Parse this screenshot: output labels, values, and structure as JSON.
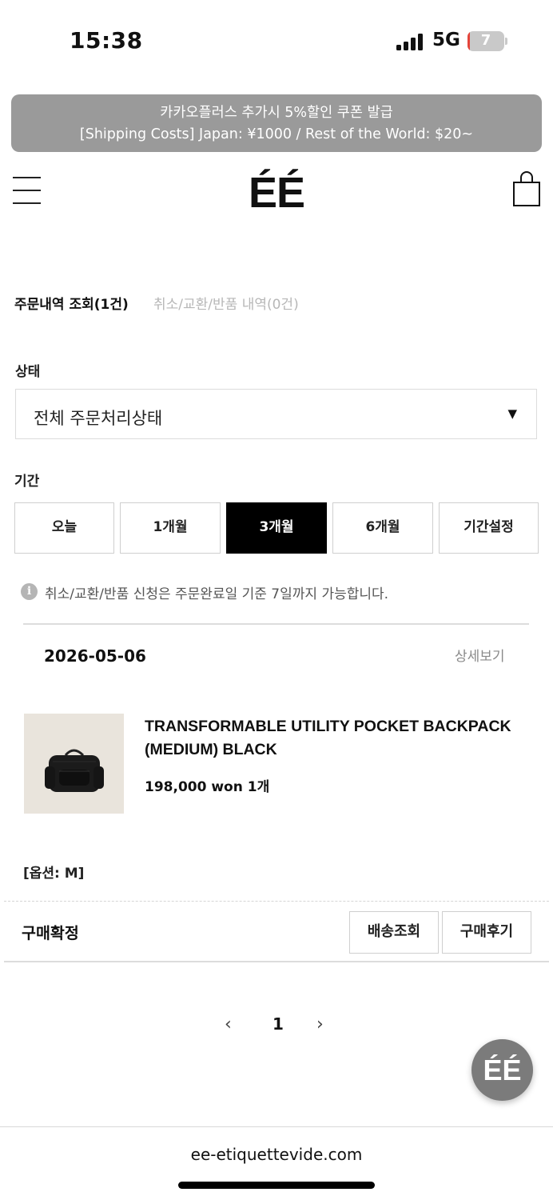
{
  "status_bar": {
    "time": "15:38",
    "network": "5G",
    "battery_level": "7",
    "battery_fraction": 0.07,
    "battery_color": "#e5443a"
  },
  "banner": {
    "line1": "카카오플러스 추가시 5%할인 쿠폰 발급",
    "line2": "[Shipping Costs] Japan: ¥1000 / Rest of the World: $20~",
    "background": "#9a9a9a"
  },
  "header": {
    "logo": "ÉÉ",
    "menu_icon": "hamburger-menu-icon",
    "cart_icon": "shopping-bag-icon"
  },
  "tabs": {
    "orders": "주문내역 조회(1건)",
    "cancellations": "취소/교환/반품 내역(0건)"
  },
  "filter": {
    "status_label": "상태",
    "status_value": "전체 주문처리상태",
    "period_label": "기간",
    "periods": [
      "오늘",
      "1개월",
      "3개월",
      "6개월",
      "기간설정"
    ],
    "selected_period": "3개월"
  },
  "notice": {
    "icon": "info-icon",
    "text": "취소/교환/반품 신청은 주문완료일 기준 7일까지 가능합니다."
  },
  "order": {
    "date": "2026-05-06",
    "detail_link": "상세보기",
    "product_name": "TRANSFORMABLE UTILITY POCKET BACKPACK (MEDIUM) BLACK",
    "price_qty": "198,000 won 1개",
    "option": "[옵션: M]",
    "status": "구매확정",
    "actions": [
      "배송조회",
      "구매후기"
    ]
  },
  "pagination": {
    "prev": "‹",
    "current": "1",
    "next": "›"
  },
  "fab": {
    "label": "ÉÉ"
  },
  "footer": {
    "url": "ee-etiquettevide.com"
  }
}
